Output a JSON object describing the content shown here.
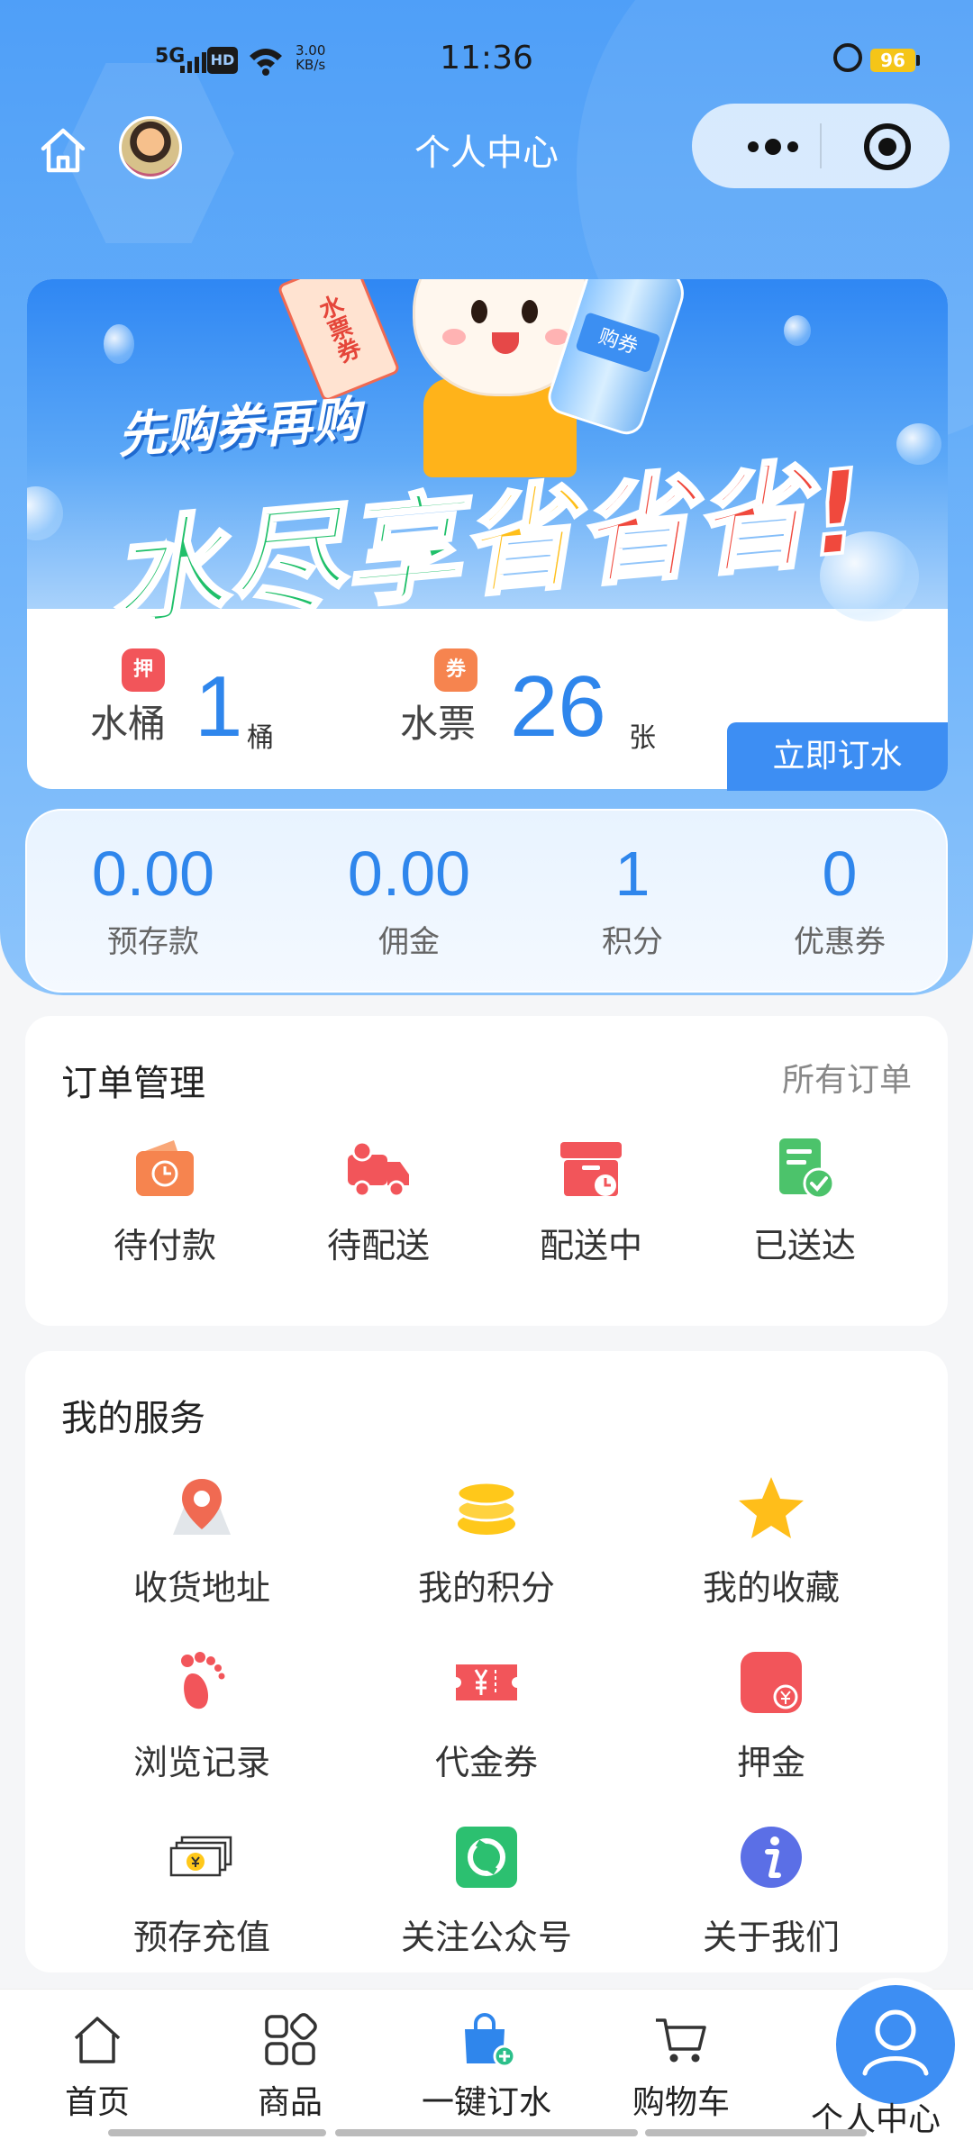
{
  "status_bar": {
    "network": "5G",
    "hd": "HD",
    "speed_value": "3.00",
    "speed_unit": "KB/s",
    "time": "11:36",
    "battery": "96"
  },
  "nav": {
    "title": "个人中心"
  },
  "banner": {
    "slogan_small": "先购券再购",
    "slogan_big_1": "水尽享",
    "slogan_big_2": "省",
    "slogan_big_3": "省省!",
    "ticket_text": "水票券",
    "bottle_label": "购券"
  },
  "stats": {
    "bucket": {
      "icon_text": "押",
      "label": "水桶",
      "value": "1",
      "unit": "桶"
    },
    "ticket": {
      "icon_text": "券",
      "label": "水票",
      "value": "26",
      "unit": "张"
    },
    "order_button": "立即订水"
  },
  "balances": [
    {
      "value": "0.00",
      "label": "预存款"
    },
    {
      "value": "0.00",
      "label": "佣金"
    },
    {
      "value": "1",
      "label": "积分"
    },
    {
      "value": "0",
      "label": "优惠券"
    }
  ],
  "orders": {
    "title": "订单管理",
    "all_link": "所有订单",
    "items": [
      {
        "label": "待付款",
        "icon": "wallet-clock-icon",
        "color": "#f6844f"
      },
      {
        "label": "待配送",
        "icon": "delivery-truck-icon",
        "color": "#f2555a"
      },
      {
        "label": "配送中",
        "icon": "box-clock-icon",
        "color": "#f2555a"
      },
      {
        "label": "已送达",
        "icon": "document-check-icon",
        "color": "#4cc36b"
      }
    ]
  },
  "services": {
    "title": "我的服务",
    "items": [
      {
        "label": "收货地址",
        "icon": "location-pin-icon"
      },
      {
        "label": "我的积分",
        "icon": "coins-icon"
      },
      {
        "label": "我的收藏",
        "icon": "star-icon"
      },
      {
        "label": "浏览记录",
        "icon": "footprint-icon"
      },
      {
        "label": "代金券",
        "icon": "voucher-icon"
      },
      {
        "label": "押金",
        "icon": "deposit-icon",
        "icon_text": "押"
      },
      {
        "label": "预存充值",
        "icon": "cash-stack-icon"
      },
      {
        "label": "关注公众号",
        "icon": "wechat-official-icon"
      },
      {
        "label": "关于我们",
        "icon": "info-icon",
        "icon_text": "i"
      }
    ]
  },
  "tabbar": [
    {
      "label": "首页",
      "icon": "home-icon"
    },
    {
      "label": "商品",
      "icon": "grid-icon"
    },
    {
      "label": "一键订水",
      "icon": "shopping-bag-plus-icon"
    },
    {
      "label": "购物车",
      "icon": "cart-icon"
    },
    {
      "label": "个人中心",
      "icon": "user-icon"
    }
  ],
  "colors": {
    "primary": "#3d8ef3",
    "number": "#2f86ec",
    "red": "#f2555a",
    "green": "#4cc36b",
    "gold": "#ffc81a"
  }
}
